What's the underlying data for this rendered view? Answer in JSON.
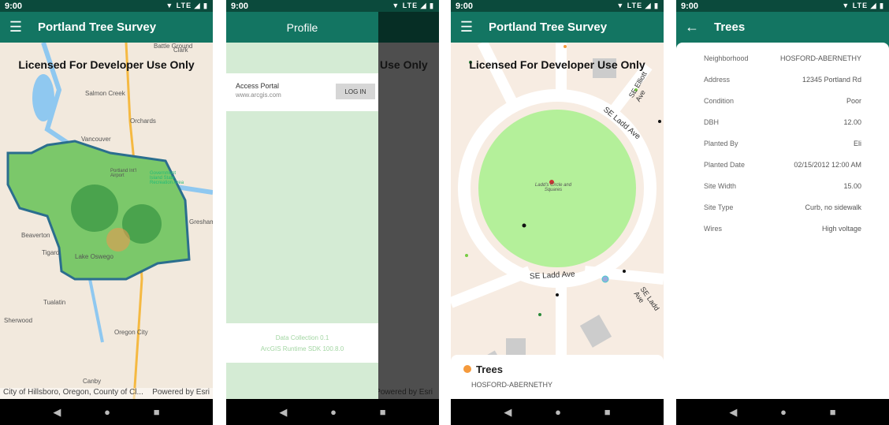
{
  "status": {
    "time": "9:00",
    "network": "LTE"
  },
  "screen1": {
    "title": "Portland Tree Survey",
    "watermark": "Licensed For Developer Use Only",
    "map_labels": [
      "Battle Ground",
      "Clark",
      "Salmon Creek",
      "Orchards",
      "Vancouver",
      "Portland Int'l Airport",
      "Government Island State Recreation Area",
      "Beaverton",
      "Gresham",
      "Tigard",
      "Lake Oswego",
      "Tualatin",
      "Sherwood",
      "Oregon City",
      "Canby"
    ],
    "attribution": "City of Hillsboro, Oregon, County of Cl...",
    "powered_by": "Powered by Esri"
  },
  "screen2": {
    "drawer_title": "Profile",
    "portal_title": "Access Portal",
    "portal_url": "www.arcgis.com",
    "login_label": "LOG IN",
    "app_version": "Data Collection 0.1",
    "sdk_version": "ArcGIS Runtime SDK 100.8.0",
    "background_watermark": "Use Only",
    "powered_by": "Powered by Esri"
  },
  "screen3": {
    "title": "Portland Tree Survey",
    "watermark": "Licensed For Developer Use Only",
    "map_labels": [
      "SE Ladd Ave",
      "SE Ladd Ave",
      "SE Elliott Ave",
      "Ladd's Circle and Squares",
      "SE Ladd Ave"
    ],
    "card_title": "Trees",
    "card_subtitle": "HOSFORD-ABERNETHY",
    "card_dot_color": "#f59a3c"
  },
  "screen4": {
    "title": "Trees",
    "fields": [
      {
        "label": "Neighborhood",
        "value": "HOSFORD-ABERNETHY"
      },
      {
        "label": "Address",
        "value": "12345 Portland Rd"
      },
      {
        "label": "Condition",
        "value": "Poor"
      },
      {
        "label": "DBH",
        "value": "12.00"
      },
      {
        "label": "Planted By",
        "value": "Eli"
      },
      {
        "label": "Planted Date",
        "value": "02/15/2012 12:00 AM"
      },
      {
        "label": "Site Width",
        "value": "15.00"
      },
      {
        "label": "Site Type",
        "value": "Curb, no sidewalk"
      },
      {
        "label": "Wires",
        "value": "High voltage"
      }
    ]
  },
  "colors": {
    "primary": "#137562",
    "status_bar": "#0b4a3c",
    "drawer_bg": "#d4ebd4"
  }
}
